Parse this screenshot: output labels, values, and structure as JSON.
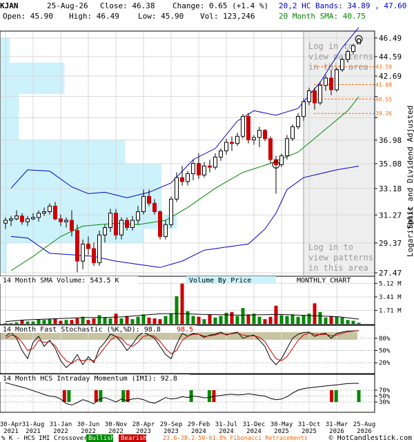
{
  "header": {
    "ticker": "KJAN",
    "date": "25-Aug-26",
    "close_label": "Close: 46.38",
    "change_label": "Change: 0.65 (+1.4 %)",
    "open_label": "Open: 45.90",
    "high_label": "High: 46.49",
    "low_label": "Low: 45.90",
    "vol_label": "Vol: 123,246",
    "bands_legend": "20,2 HC Bands: 34.89 , 47.60",
    "sma_legend": "20 Month SMA: 40.75"
  },
  "colors": {
    "bands": "#0000cc",
    "sma": "#008800",
    "up": "#008800",
    "down": "#cc0000",
    "vbp": "#ccf2fc",
    "fib": "#ff6600",
    "stoch_fill": "#c8c4a0"
  },
  "overlay_texts": [
    "Log in to",
    "view patterns",
    "in this area"
  ],
  "right_axis_label": "Split and Dividend Adjusted",
  "log_label": "Logarithmic",
  "footer": {
    "prefix": "% K - HCS IMI Crossover:",
    "bullish": "Bullish",
    "bearish": "Bearish",
    "fib_text": "23.6-38.2-50-61.8% Fibonacci Retracements",
    "copyright": "© HotCandlestick.com"
  },
  "chart_data": [
    {
      "type": "candlestick",
      "panel": "price",
      "scale": "log",
      "ylim": [
        27.47,
        46.49
      ],
      "y_ticks": [
        46.49,
        44.59,
        42.69,
        40.78,
        38.88,
        36.98,
        35.08,
        33.18,
        31.27,
        29.37,
        27.47
      ],
      "y_tick_labels": [
        "46.49",
        "44.59",
        "42.69",
        "",
        "",
        "36.98",
        "35.08",
        "33.18",
        "31.27",
        "29.37",
        "27.47"
      ],
      "fib_levels": [
        43.59,
        41.88,
        40.55,
        39.26
      ],
      "x_tick_labels": [
        {
          "t": 0,
          "label": [
            "30-Apr",
            "2021"
          ]
        },
        {
          "t": 4,
          "label": [
            "31-Aug",
            "2021"
          ]
        },
        {
          "t": 9,
          "label": [
            "31-Jan",
            "2022"
          ]
        },
        {
          "t": 14,
          "label": [
            "30-Jun",
            "2022"
          ]
        },
        {
          "t": 19,
          "label": [
            "30-Nov",
            "2022"
          ]
        },
        {
          "t": 24,
          "label": [
            "28-Apr",
            "2023"
          ]
        },
        {
          "t": 29,
          "label": [
            "29-Sep",
            "2023"
          ]
        },
        {
          "t": 34,
          "label": [
            "29-Feb",
            "2024"
          ]
        },
        {
          "t": 39,
          "label": [
            "31-Jul",
            "2024"
          ]
        },
        {
          "t": 44,
          "label": [
            "31-Dec",
            "2024"
          ]
        },
        {
          "t": 49,
          "label": [
            "30-May",
            "2025"
          ]
        },
        {
          "t": 54,
          "label": [
            "31-Oct",
            "2025"
          ]
        },
        {
          "t": 59,
          "label": [
            "31-Mar",
            "2026"
          ]
        },
        {
          "t": 64,
          "label": [
            "25-Aug",
            "2026"
          ]
        }
      ],
      "candles": [
        {
          "o": 30.7,
          "h": 31.1,
          "l": 30.3,
          "c": 30.9
        },
        {
          "o": 30.9,
          "h": 31.2,
          "l": 30.5,
          "c": 31.0
        },
        {
          "o": 31.0,
          "h": 31.6,
          "l": 30.9,
          "c": 31.2
        },
        {
          "o": 31.2,
          "h": 31.4,
          "l": 30.6,
          "c": 30.8
        },
        {
          "o": 30.8,
          "h": 31.2,
          "l": 30.5,
          "c": 31.0
        },
        {
          "o": 31.0,
          "h": 31.4,
          "l": 30.9,
          "c": 31.1
        },
        {
          "o": 31.1,
          "h": 31.6,
          "l": 30.8,
          "c": 31.4
        },
        {
          "o": 31.4,
          "h": 31.8,
          "l": 31.2,
          "c": 31.5
        },
        {
          "o": 31.5,
          "h": 32.1,
          "l": 31.3,
          "c": 31.9
        },
        {
          "o": 31.9,
          "h": 32.2,
          "l": 30.9,
          "c": 31.0
        },
        {
          "o": 31.0,
          "h": 31.3,
          "l": 30.5,
          "c": 30.8
        },
        {
          "o": 30.8,
          "h": 31.1,
          "l": 30.4,
          "c": 30.9
        },
        {
          "o": 30.9,
          "h": 31.6,
          "l": 29.8,
          "c": 30.2
        },
        {
          "o": 30.2,
          "h": 30.6,
          "l": 27.5,
          "c": 28.2
        },
        {
          "o": 28.2,
          "h": 29.6,
          "l": 27.7,
          "c": 29.3
        },
        {
          "o": 29.3,
          "h": 29.8,
          "l": 28.6,
          "c": 29.0
        },
        {
          "o": 29.0,
          "h": 29.4,
          "l": 27.9,
          "c": 28.1
        },
        {
          "o": 28.1,
          "h": 30.2,
          "l": 27.9,
          "c": 29.9
        },
        {
          "o": 29.9,
          "h": 30.6,
          "l": 29.4,
          "c": 30.4
        },
        {
          "o": 30.4,
          "h": 31.7,
          "l": 30.1,
          "c": 31.4
        },
        {
          "o": 31.4,
          "h": 31.7,
          "l": 29.6,
          "c": 29.9
        },
        {
          "o": 29.9,
          "h": 31.1,
          "l": 29.6,
          "c": 30.9
        },
        {
          "o": 30.9,
          "h": 31.1,
          "l": 30.2,
          "c": 30.4
        },
        {
          "o": 30.4,
          "h": 31.2,
          "l": 30.2,
          "c": 30.9
        },
        {
          "o": 30.9,
          "h": 31.9,
          "l": 30.6,
          "c": 31.5
        },
        {
          "o": 31.5,
          "h": 33.1,
          "l": 31.3,
          "c": 32.6
        },
        {
          "o": 32.6,
          "h": 33.1,
          "l": 31.9,
          "c": 32.1
        },
        {
          "o": 32.1,
          "h": 32.4,
          "l": 31.3,
          "c": 31.5
        },
        {
          "o": 31.5,
          "h": 31.6,
          "l": 29.6,
          "c": 29.8
        },
        {
          "o": 29.8,
          "h": 30.9,
          "l": 29.6,
          "c": 30.6
        },
        {
          "o": 30.6,
          "h": 32.6,
          "l": 30.4,
          "c": 32.4
        },
        {
          "o": 32.4,
          "h": 34.4,
          "l": 32.2,
          "c": 34.0
        },
        {
          "o": 34.0,
          "h": 34.9,
          "l": 33.4,
          "c": 33.7
        },
        {
          "o": 33.7,
          "h": 34.5,
          "l": 33.4,
          "c": 34.3
        },
        {
          "o": 34.3,
          "h": 35.4,
          "l": 33.8,
          "c": 35.1
        },
        {
          "o": 35.1,
          "h": 35.9,
          "l": 33.9,
          "c": 34.2
        },
        {
          "o": 34.2,
          "h": 35.2,
          "l": 34.0,
          "c": 34.9
        },
        {
          "o": 34.9,
          "h": 35.4,
          "l": 34.4,
          "c": 34.8
        },
        {
          "o": 34.8,
          "h": 35.9,
          "l": 34.6,
          "c": 35.6
        },
        {
          "o": 35.6,
          "h": 36.3,
          "l": 35.3,
          "c": 36.1
        },
        {
          "o": 36.1,
          "h": 37.1,
          "l": 35.8,
          "c": 36.8
        },
        {
          "o": 36.8,
          "h": 37.3,
          "l": 36.1,
          "c": 36.7
        },
        {
          "o": 36.7,
          "h": 37.6,
          "l": 36.5,
          "c": 37.3
        },
        {
          "o": 37.3,
          "h": 39.2,
          "l": 37.1,
          "c": 39.0
        },
        {
          "o": 39.0,
          "h": 39.3,
          "l": 36.7,
          "c": 37.0
        },
        {
          "o": 37.0,
          "h": 37.4,
          "l": 36.6,
          "c": 37.2
        },
        {
          "o": 37.2,
          "h": 38.1,
          "l": 36.4,
          "c": 37.8
        },
        {
          "o": 37.8,
          "h": 37.9,
          "l": 36.9,
          "c": 37.1
        },
        {
          "o": 37.1,
          "h": 37.3,
          "l": 35.1,
          "c": 35.4
        },
        {
          "o": 35.4,
          "h": 35.7,
          "l": 32.8,
          "c": 35.0
        },
        {
          "o": 35.0,
          "h": 35.9,
          "l": 34.8,
          "c": 35.7
        },
        {
          "o": 35.7,
          "h": 37.4,
          "l": 35.4,
          "c": 37.1
        },
        {
          "o": 37.1,
          "h": 38.3,
          "l": 36.9,
          "c": 38.1
        },
        {
          "o": 38.1,
          "h": 39.3,
          "l": 37.9,
          "c": 39.0
        },
        {
          "o": 39.0,
          "h": 40.6,
          "l": 38.6,
          "c": 40.3
        },
        {
          "o": 40.3,
          "h": 41.6,
          "l": 40.0,
          "c": 41.3
        },
        {
          "o": 41.3,
          "h": 41.6,
          "l": 39.6,
          "c": 40.2
        },
        {
          "o": 40.2,
          "h": 42.1,
          "l": 40.0,
          "c": 41.8
        },
        {
          "o": 41.8,
          "h": 42.8,
          "l": 41.3,
          "c": 42.5
        },
        {
          "o": 42.5,
          "h": 43.3,
          "l": 40.9,
          "c": 41.4
        },
        {
          "o": 41.4,
          "h": 43.5,
          "l": 41.2,
          "c": 43.3
        },
        {
          "o": 43.3,
          "h": 44.5,
          "l": 43.1,
          "c": 44.3
        },
        {
          "o": 44.3,
          "h": 45.3,
          "l": 44.0,
          "c": 45.1
        },
        {
          "o": 45.1,
          "h": 45.9,
          "l": 44.8,
          "c": 45.7
        },
        {
          "o": 45.9,
          "h": 46.49,
          "l": 45.9,
          "c": 46.38
        }
      ],
      "sma": [
        {
          "t": 1,
          "v": 27.6
        },
        {
          "t": 5,
          "v": 28.5
        },
        {
          "t": 10,
          "v": 29.8
        },
        {
          "t": 14,
          "v": 30.5
        },
        {
          "t": 20,
          "v": 30.7
        },
        {
          "t": 24,
          "v": 30.6
        },
        {
          "t": 29,
          "v": 30.9
        },
        {
          "t": 33,
          "v": 31.8
        },
        {
          "t": 38,
          "v": 33.2
        },
        {
          "t": 43,
          "v": 34.4
        },
        {
          "t": 48,
          "v": 35.1
        },
        {
          "t": 53,
          "v": 36.0
        },
        {
          "t": 58,
          "v": 37.9
        },
        {
          "t": 62,
          "v": 39.5
        },
        {
          "t": 64,
          "v": 40.75
        }
      ],
      "band_upper": [
        {
          "t": 1,
          "v": 33.2
        },
        {
          "t": 4,
          "v": 34.6
        },
        {
          "t": 8,
          "v": 34.5
        },
        {
          "t": 12,
          "v": 33.3
        },
        {
          "t": 15,
          "v": 32.8
        },
        {
          "t": 18,
          "v": 32.9
        },
        {
          "t": 22,
          "v": 32.5
        },
        {
          "t": 26,
          "v": 32.9
        },
        {
          "t": 30,
          "v": 33.6
        },
        {
          "t": 34,
          "v": 35.4
        },
        {
          "t": 38,
          "v": 36.3
        },
        {
          "t": 42,
          "v": 38.6
        },
        {
          "t": 45,
          "v": 39.5
        },
        {
          "t": 49,
          "v": 39.1
        },
        {
          "t": 53,
          "v": 39.7
        },
        {
          "t": 57,
          "v": 42.1
        },
        {
          "t": 61,
          "v": 45.5
        },
        {
          "t": 64,
          "v": 47.6
        }
      ],
      "band_lower": [
        {
          "t": 1,
          "v": 29.8
        },
        {
          "t": 4,
          "v": 29.7
        },
        {
          "t": 8,
          "v": 28.7
        },
        {
          "t": 12,
          "v": 28.6
        },
        {
          "t": 16,
          "v": 28.5
        },
        {
          "t": 20,
          "v": 28.2
        },
        {
          "t": 24,
          "v": 28.0
        },
        {
          "t": 28,
          "v": 27.8
        },
        {
          "t": 32,
          "v": 28.2
        },
        {
          "t": 36,
          "v": 28.9
        },
        {
          "t": 40,
          "v": 29.1
        },
        {
          "t": 44,
          "v": 29.3
        },
        {
          "t": 47,
          "v": 30.3
        },
        {
          "t": 49,
          "v": 31.4
        },
        {
          "t": 51,
          "v": 33.1
        },
        {
          "t": 54,
          "v": 34.0
        },
        {
          "t": 57,
          "v": 34.3
        },
        {
          "t": 60,
          "v": 34.6
        },
        {
          "t": 64,
          "v": 34.89
        }
      ],
      "volume_by_price": [
        {
          "low": 27.47,
          "high": 29.37,
          "rel": 0.02
        },
        {
          "low": 29.37,
          "high": 30.3,
          "rel": 0.47
        },
        {
          "low": 30.3,
          "high": 31.27,
          "rel": 0.58
        },
        {
          "low": 31.27,
          "high": 33.18,
          "rel": 0.53
        },
        {
          "low": 33.18,
          "high": 35.08,
          "rel": 0.53
        },
        {
          "low": 35.08,
          "high": 36.98,
          "rel": 0.41
        },
        {
          "low": 36.98,
          "high": 41.0,
          "rel": 0.06
        },
        {
          "low": 41.0,
          "high": 44.0,
          "rel": 0.21
        },
        {
          "low": 44.0,
          "high": 46.49,
          "rel": 0.03
        }
      ],
      "patterns": [
        {
          "t": 49,
          "price": 35.0
        },
        {
          "t": 64,
          "price": 46.38
        }
      ]
    },
    {
      "type": "bar",
      "panel": "volume",
      "title": "14 Month SMA Volume: 543.5 K",
      "center_label": "Volume By Price",
      "right_label": "MONTHLY CHART",
      "y_ticks": [
        5.12,
        3.41,
        1.71
      ],
      "y_tick_labels": [
        "5.12 M",
        "3.41 M",
        "1.71 M"
      ],
      "ylim": [
        0,
        5.5
      ],
      "values": [
        0.1,
        0.1,
        0.2,
        0.5,
        0.3,
        0.3,
        0.6,
        0.5,
        0.6,
        0.7,
        0.4,
        0.5,
        0.5,
        0.7,
        0.9,
        0.5,
        0.7,
        1.1,
        0.8,
        0.7,
        1.3,
        0.7,
        1.0,
        0.6,
        0.9,
        1.2,
        0.8,
        0.7,
        0.6,
        1.0,
        1.3,
        3.5,
        5.1,
        1.6,
        1.0,
        0.9,
        0.6,
        1.2,
        0.8,
        1.0,
        1.4,
        1.5,
        1.0,
        2.0,
        1.2,
        1.3,
        0.9,
        0.6,
        0.9,
        2.3,
        1.1,
        1.0,
        1.2,
        0.9,
        1.1,
        1.3,
        2.6,
        1.5,
        0.8,
        1.0,
        0.9,
        0.8,
        0.5,
        0.4,
        0.15
      ],
      "sma": [
        0.3,
        0.5,
        0.6,
        0.7,
        0.8,
        0.8,
        0.9,
        1.1,
        1.3,
        1.3,
        1.2,
        1.15,
        1.1,
        1.15,
        1.2,
        1.1,
        1.0,
        0.9,
        0.6
      ]
    },
    {
      "type": "line",
      "panel": "stochastic",
      "title": "14 Month Fast Stochastic (%K,%D): 98.8, 98.5",
      "title_main": "14 Month Fast Stochastic (%K,%D): 98.8",
      "title_tail": "98.5",
      "y_ticks": [
        80,
        50,
        20
      ],
      "y_tick_labels": [
        "80%",
        "50%",
        "20%"
      ],
      "ylim": [
        0,
        100
      ],
      "k": [
        85,
        95,
        80,
        50,
        30,
        70,
        85,
        60,
        75,
        55,
        25,
        8,
        20,
        40,
        15,
        35,
        20,
        55,
        70,
        90,
        85,
        70,
        50,
        65,
        85,
        95,
        88,
        80,
        60,
        40,
        30,
        65,
        92,
        85,
        92,
        90,
        82,
        88,
        90,
        95,
        88,
        92,
        95,
        80,
        85,
        88,
        75,
        60,
        30,
        15,
        30,
        55,
        80,
        90,
        94,
        95,
        85,
        90,
        92,
        80,
        92,
        95,
        98,
        98,
        98.8
      ],
      "d": [
        80,
        88,
        85,
        70,
        50,
        55,
        75,
        70,
        72,
        62,
        40,
        25,
        18,
        28,
        25,
        28,
        25,
        40,
        58,
        75,
        85,
        80,
        65,
        60,
        70,
        85,
        88,
        85,
        72,
        55,
        42,
        50,
        75,
        85,
        90,
        90,
        85,
        86,
        88,
        92,
        90,
        91,
        93,
        88,
        86,
        86,
        82,
        72,
        50,
        30,
        25,
        35,
        55,
        75,
        88,
        93,
        90,
        89,
        90,
        86,
        88,
        92,
        96,
        97,
        98.5
      ]
    },
    {
      "type": "line",
      "panel": "momentum",
      "title": "14 Month HCS Intraday Momentum (IMI): 92.8",
      "y_ticks": [
        70,
        50,
        30
      ],
      "y_tick_labels": [
        "70%",
        "50%",
        "30%"
      ],
      "ylim": [
        0,
        100
      ],
      "values": [
        95,
        90,
        85,
        80,
        75,
        68,
        62,
        55,
        50,
        48,
        40,
        25,
        20,
        28,
        38,
        32,
        24,
        40,
        45,
        38,
        30,
        40,
        35,
        40,
        42,
        38,
        30,
        26,
        35,
        45,
        40,
        42,
        48,
        45,
        50,
        48,
        44,
        46,
        50,
        52,
        55,
        56,
        54,
        55,
        58,
        55,
        52,
        50,
        42,
        38,
        40,
        48,
        60,
        70,
        75,
        78,
        80,
        82,
        84,
        86,
        88,
        90,
        92,
        92.8,
        92.8
      ],
      "crossovers": [
        {
          "t": 13,
          "kind": "bearish"
        },
        {
          "t": 14,
          "kind": "bullish"
        },
        {
          "t": 20,
          "kind": "bearish"
        },
        {
          "t": 21,
          "kind": "bullish"
        },
        {
          "t": 26,
          "kind": "bullish"
        },
        {
          "t": 27,
          "kind": "bearish"
        },
        {
          "t": 41,
          "kind": "bullish"
        },
        {
          "t": 45,
          "kind": "bullish"
        },
        {
          "t": 46,
          "kind": "bearish"
        },
        {
          "t": 72,
          "kind": "bearish"
        },
        {
          "t": 73,
          "kind": "bullish"
        },
        {
          "t": 78,
          "kind": "bullish"
        }
      ]
    }
  ]
}
